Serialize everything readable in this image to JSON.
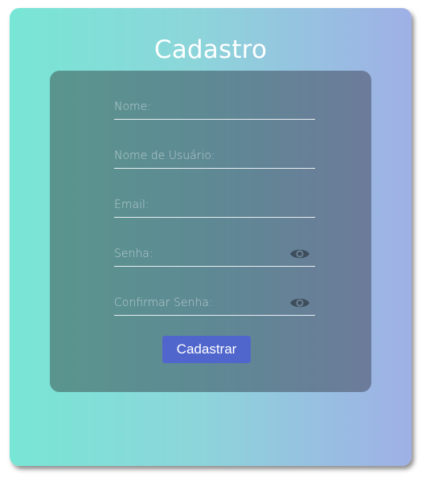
{
  "form": {
    "title": "Cadastro",
    "fields": [
      {
        "placeholder": "Nome:",
        "type": "text",
        "value": ""
      },
      {
        "placeholder": "Nome de Usuário:",
        "type": "text",
        "value": ""
      },
      {
        "placeholder": "Email:",
        "type": "email",
        "value": ""
      },
      {
        "placeholder": "Senha:",
        "type": "password",
        "value": "",
        "icon": "eye-icon"
      },
      {
        "placeholder": "Confirmar Senha:",
        "type": "password",
        "value": "",
        "icon": "eye-icon"
      }
    ],
    "submit_label": "Cadastrar"
  },
  "colors": {
    "background_gradient": [
      "#78e6d5",
      "#9fb0e6"
    ],
    "panel_gradient": [
      "#5a958d",
      "#6c7b9a"
    ],
    "button": "#5066cc",
    "text": "#ffffff"
  }
}
